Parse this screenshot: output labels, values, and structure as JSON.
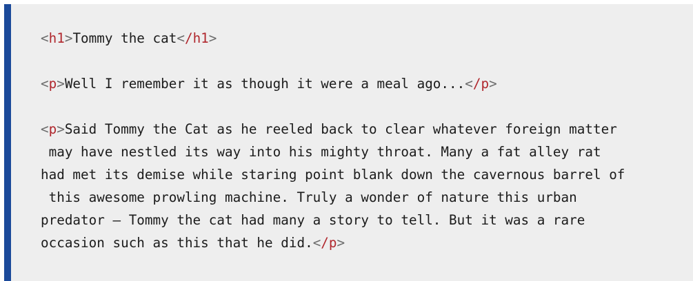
{
  "code": {
    "h1_open_tag": "h1",
    "h1_text": "Tommy the cat",
    "h1_close_tag": "/h1",
    "p1_open_tag": "p",
    "p1_text": "Well I remember it as though it were a meal ago...",
    "p1_close_tag": "/p",
    "p2_open_tag": "p",
    "p2_lines": [
      "Said Tommy the Cat as he reeled back to clear whatever foreign matter",
      " may have nestled its way into his mighty throat. Many a fat alley rat",
      "had met its demise while staring point blank down the cavernous barrel of",
      " this awesome prowling machine. Truly a wonder of nature this urban",
      "predator — Tommy the cat had many a story to tell. But it was a rare",
      "occasion such as this that he did."
    ],
    "p2_close_tag": "/p"
  },
  "colors": {
    "background": "#eeeeee",
    "accent_border": "#1b4a9a",
    "tag_name": "#b0272d",
    "punctuation": "#6b6b6b",
    "text": "#1b1b1b"
  }
}
